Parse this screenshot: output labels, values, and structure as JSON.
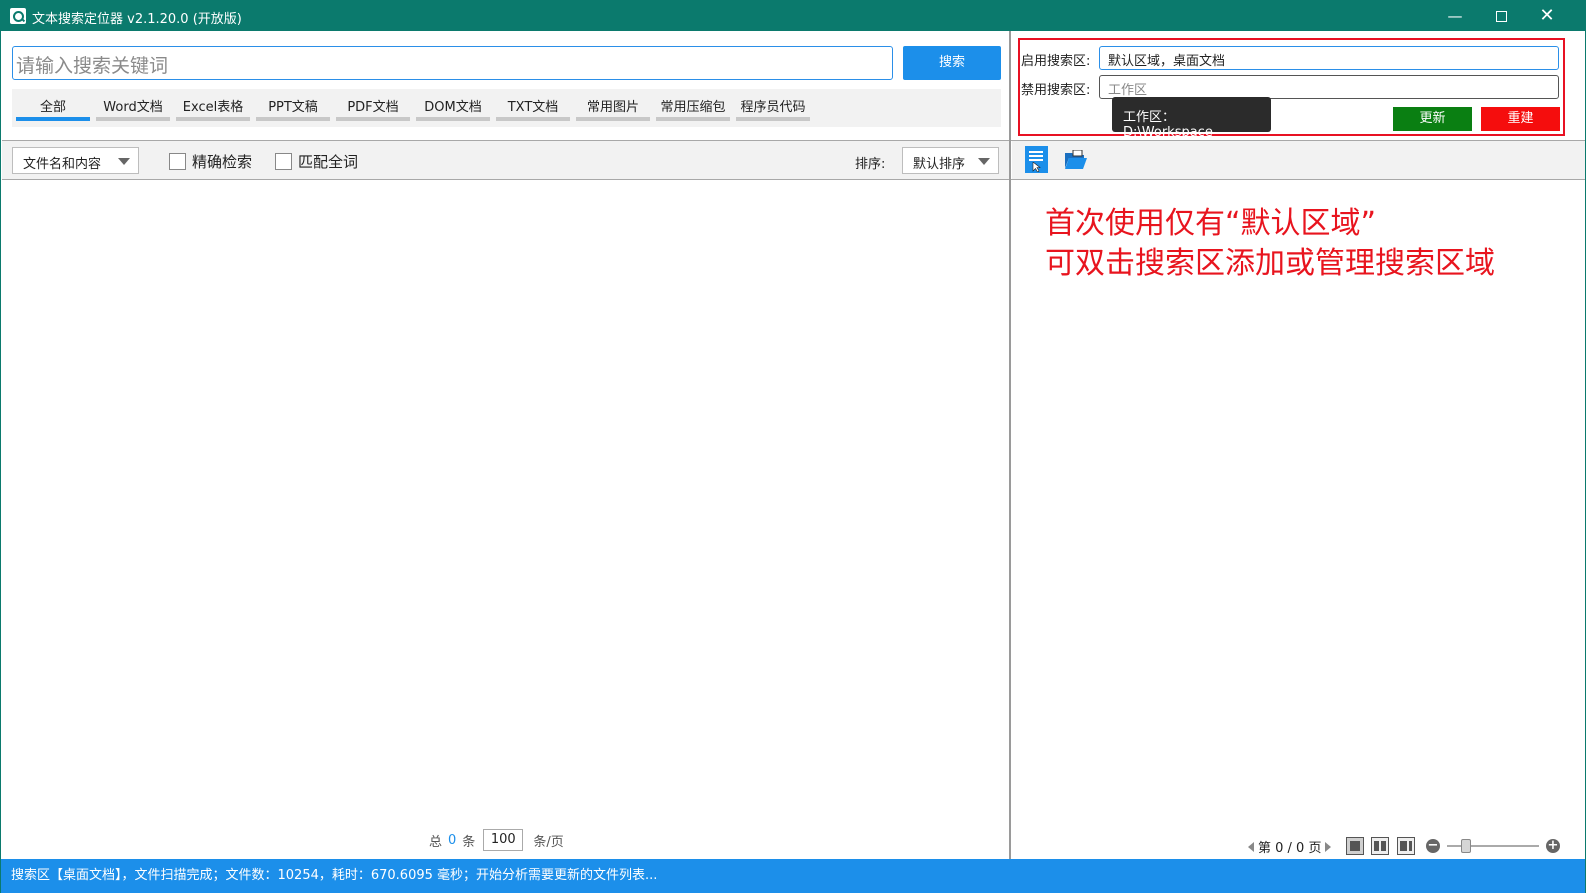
{
  "window": {
    "title": "文本搜索定位器 v2.1.20.0 (开放版)",
    "minimize_glyph": "—",
    "close_glyph": "✕"
  },
  "search": {
    "placeholder": "请输入搜索关键词",
    "button_label": "搜索"
  },
  "tabs": [
    {
      "label": "全部",
      "active": true
    },
    {
      "label": "Word文档"
    },
    {
      "label": "Excel表格"
    },
    {
      "label": "PPT文稿"
    },
    {
      "label": "PDF文档"
    },
    {
      "label": "DOM文档"
    },
    {
      "label": "TXT文档"
    },
    {
      "label": "常用图片"
    },
    {
      "label": "常用压缩包"
    },
    {
      "label": "程序员代码"
    }
  ],
  "filters": {
    "scope_select": "文件名和内容",
    "exact_search": "精确检索",
    "whole_word": "匹配全词",
    "sort_label": "排序:",
    "sort_select": "默认排序"
  },
  "pager": {
    "total_prefix": "总",
    "total_count": "0",
    "total_suffix": "条",
    "page_size": "100",
    "page_size_suffix": "条/页"
  },
  "search_area": {
    "enabled_label": "启用搜索区:",
    "enabled_value": "默认区域，桌面文档",
    "disabled_label": "禁用搜索区:",
    "disabled_value": "工作区",
    "update_button": "更新",
    "rebuild_button": "重建",
    "tooltip": "工作区：D:\\Workspace"
  },
  "hint": {
    "line1": "首次使用仅有“默认区域”",
    "line2": "可双击搜索区添加或管理搜索区域"
  },
  "preview_pager": {
    "page_text": "第 0 / 0 页"
  },
  "zoom": {
    "minus": "−",
    "plus": "+"
  },
  "status": {
    "text": "搜索区【桌面文档】，文件扫描完成；文件数：10254，耗时：670.6095 毫秒；开始分析需要更新的文件列表..."
  },
  "icons": {
    "app": "magnifier-app-icon",
    "doc": "document-list-icon",
    "folder": "open-folder-icon"
  },
  "colors": {
    "titlebar": "#0b7a6d",
    "accent": "#1c8fea",
    "update": "#0a7f12",
    "rebuild": "#f50d0d",
    "hint": "#e8141e"
  }
}
